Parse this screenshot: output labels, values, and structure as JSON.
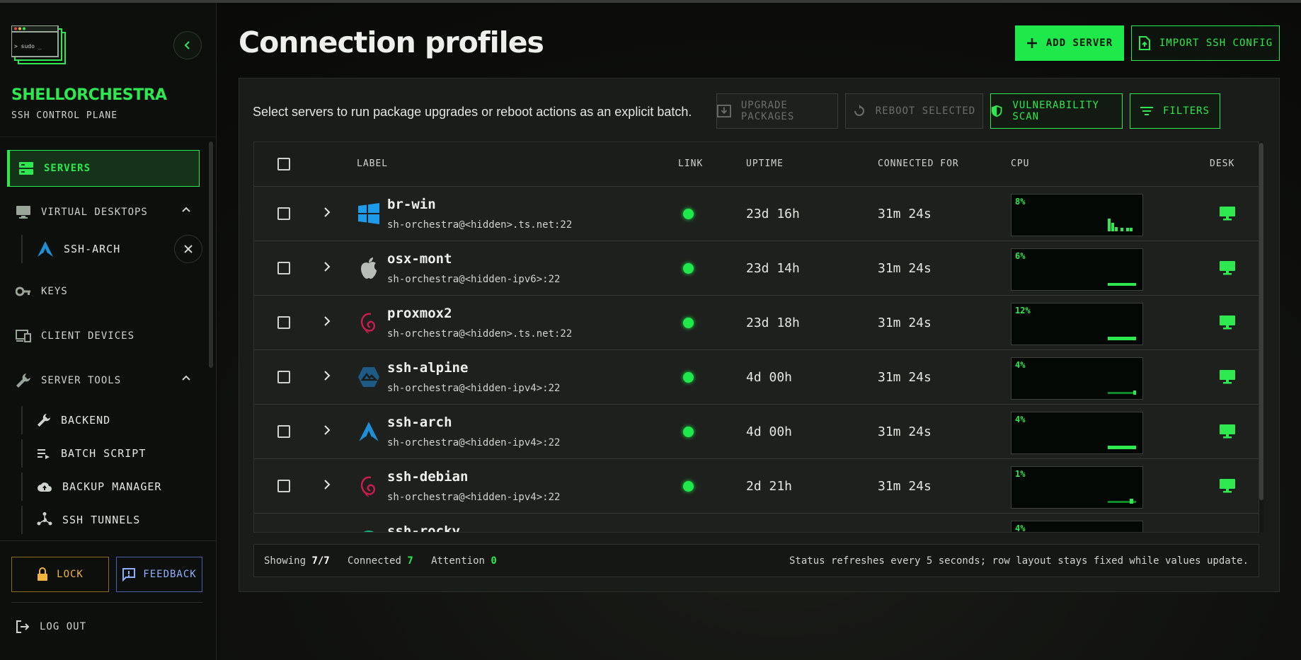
{
  "brand": {
    "name": "SHELLORCHESTRA",
    "subtitle": "SSH CONTROL PLANE",
    "logo_text": "> sudo _"
  },
  "sidebar": {
    "items": [
      {
        "label": "SERVERS",
        "icon": "servers-icon"
      },
      {
        "label": "VIRTUAL DESKTOPS",
        "icon": "monitor-icon"
      },
      {
        "label": "SSH-ARCH",
        "icon": "arch-linux-icon"
      },
      {
        "label": "KEYS",
        "icon": "key-icon"
      },
      {
        "label": "CLIENT DEVICES",
        "icon": "devices-icon"
      },
      {
        "label": "SERVER TOOLS",
        "icon": "wrench-icon"
      },
      {
        "label": "BACKEND",
        "icon": "wrench-icon"
      },
      {
        "label": "BATCH SCRIPT",
        "icon": "playlist-icon"
      },
      {
        "label": "BACKUP MANAGER",
        "icon": "cloud-upload-icon"
      },
      {
        "label": "SSH TUNNELS",
        "icon": "hub-icon"
      }
    ],
    "lock_label": "LOCK",
    "feedback_label": "FEEDBACK",
    "logout_label": "LOG OUT"
  },
  "header": {
    "title": "Connection profiles",
    "add_label": "ADD SERVER",
    "import_label": "IMPORT SSH CONFIG"
  },
  "toolbar": {
    "description": "Select servers to run package upgrades or reboot actions as an explicit batch.",
    "upgrade_label": "UPGRADE PACKAGES",
    "reboot_label": "REBOOT SELECTED",
    "vuln_label": "VULNERABILITY SCAN",
    "filters_label": "FILTERS"
  },
  "table": {
    "columns": {
      "label": "LABEL",
      "link": "LINK",
      "uptime": "UPTIME",
      "connected": "CONNECTED FOR",
      "cpu": "CPU",
      "desk": "DESK"
    },
    "rows": [
      {
        "name": "br-win",
        "host": "sh-orchestra@<hidden>.ts.net:22",
        "os": "windows-icon",
        "uptime": "23d 16h",
        "connected": "31m 24s",
        "cpu": "8%",
        "link": "online"
      },
      {
        "name": "osx-mont",
        "host": "sh-orchestra@<hidden-ipv6>:22",
        "os": "apple-icon",
        "uptime": "23d 14h",
        "connected": "31m 24s",
        "cpu": "6%",
        "link": "online"
      },
      {
        "name": "proxmox2",
        "host": "sh-orchestra@<hidden>.ts.net:22",
        "os": "debian-icon",
        "uptime": "23d 18h",
        "connected": "31m 24s",
        "cpu": "12%",
        "link": "online"
      },
      {
        "name": "ssh-alpine",
        "host": "sh-orchestra@<hidden-ipv4>:22",
        "os": "alpine-icon",
        "uptime": "4d 00h",
        "connected": "31m 24s",
        "cpu": "4%",
        "link": "online"
      },
      {
        "name": "ssh-arch",
        "host": "sh-orchestra@<hidden-ipv4>:22",
        "os": "arch-linux-icon",
        "uptime": "4d 00h",
        "connected": "31m 24s",
        "cpu": "4%",
        "link": "online"
      },
      {
        "name": "ssh-debian",
        "host": "sh-orchestra@<hidden-ipv4>:22",
        "os": "debian-icon",
        "uptime": "2d 21h",
        "connected": "31m 24s",
        "cpu": "1%",
        "link": "online"
      },
      {
        "name": "ssh-rocky",
        "host": "",
        "os": "rocky-icon",
        "uptime": "",
        "connected": "",
        "cpu": "4%",
        "link": "online"
      }
    ]
  },
  "footer": {
    "showing_label": "Showing",
    "showing_value": "7/7",
    "connected_label": "Connected",
    "connected_value": "7",
    "attention_label": "Attention",
    "attention_value": "0",
    "status_note": "Status refreshes every 5 seconds; row layout stays fixed while values update."
  },
  "colors": {
    "accent": "#2ee84f",
    "lock": "#f2b43c",
    "feedback": "#8fb0ff",
    "online": "#1fe84a"
  }
}
